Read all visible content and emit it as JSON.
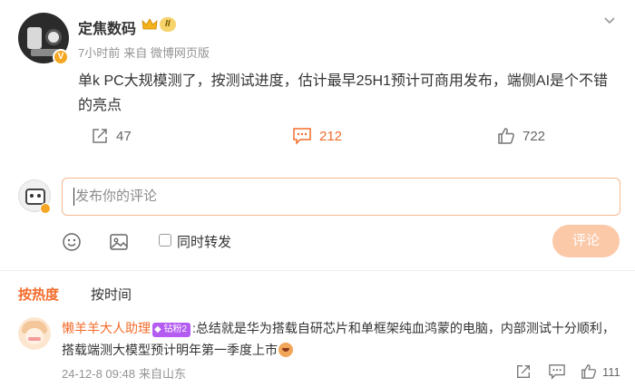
{
  "post": {
    "author": "定焦数码",
    "level": "II",
    "time": "7小时前",
    "source": "来自 微博网页版",
    "content": "单k PC大规模测了，按测试进度，估计最早25H1预计可商用发布，端侧AI是个不错的亮点",
    "actions": {
      "repost_count": "47",
      "comment_count": "212",
      "like_count": "722"
    }
  },
  "composer": {
    "placeholder": "发布你的评论",
    "repost_checkbox_label": "同时转发",
    "submit_label": "评论"
  },
  "sort": {
    "hot_label": "按热度",
    "time_label": "按时间"
  },
  "comments": [
    {
      "user": "懒羊羊大人助理",
      "badge": "钻粉2",
      "text": ":总结就是华为搭载自研芯片和单框架纯血鸿蒙的电脑，内部测试十分顺利，搭载端测大模型预计明年第一季度上市",
      "time": "24-12-8 09:48",
      "location": "来自山东",
      "like_count": "111"
    }
  ],
  "colors": {
    "accent": "#f36b2a",
    "submit_disabled": "#fbc9a8",
    "input_border": "#f7b88f",
    "meta_gray": "#939393"
  },
  "icons": {
    "repost": "repost-icon",
    "comment": "comment-icon",
    "like": "like-icon",
    "emoji": "emoji-icon",
    "image": "image-icon",
    "more": "chevron-down-icon"
  }
}
